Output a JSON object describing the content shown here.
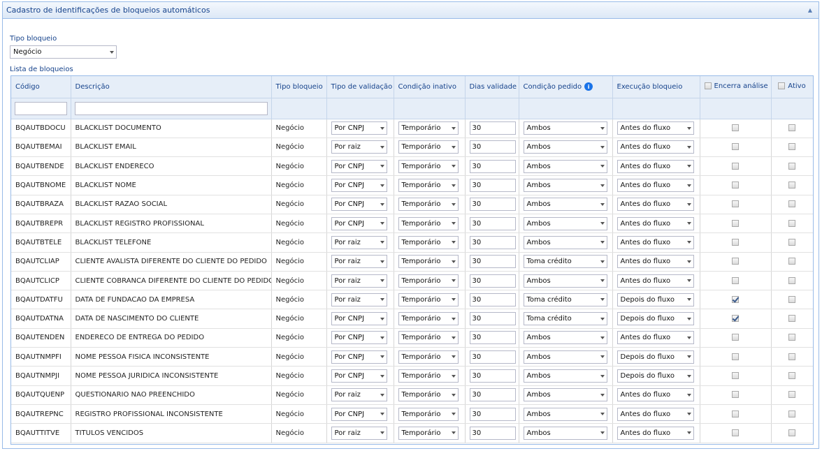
{
  "panel": {
    "title": "Cadastro de identificações de bloqueios automáticos"
  },
  "tipo_bloqueio": {
    "label": "Tipo bloqueio",
    "value": "Negócio"
  },
  "lista": {
    "label": "Lista de bloqueios"
  },
  "columns": {
    "codigo": "Código",
    "descricao": "Descrição",
    "tipo_bloqueio": "Tipo bloqueio",
    "tipo_validacao": "Tipo de validação",
    "condicao_inativo": "Condição inativo",
    "dias_validade": "Dias validade",
    "condicao_pedido": "Condição pedido",
    "execucao_bloqueio": "Execução bloqueio",
    "encerra_analise": "Encerra análise",
    "ativo": "Ativo"
  },
  "icons": {
    "info": "info-icon",
    "collapse": "chevron-up-icon",
    "dropdown": "chevron-down-icon"
  },
  "rows": [
    {
      "codigo": "BQAUTBDOCU",
      "descricao": "BLACKLIST DOCUMENTO",
      "tipo": "Negócio",
      "validacao": "Por CNPJ",
      "inativo": "Temporário",
      "dias": "30",
      "pedido": "Ambos",
      "execucao": "Antes do fluxo",
      "encerra": false,
      "ativo": false
    },
    {
      "codigo": "BQAUTBEMAI",
      "descricao": "BLACKLIST EMAIL",
      "tipo": "Negócio",
      "validacao": "Por raiz",
      "inativo": "Temporário",
      "dias": "30",
      "pedido": "Ambos",
      "execucao": "Antes do fluxo",
      "encerra": false,
      "ativo": false
    },
    {
      "codigo": "BQAUTBENDE",
      "descricao": "BLACKLIST ENDERECO",
      "tipo": "Negócio",
      "validacao": "Por CNPJ",
      "inativo": "Temporário",
      "dias": "30",
      "pedido": "Ambos",
      "execucao": "Antes do fluxo",
      "encerra": false,
      "ativo": false
    },
    {
      "codigo": "BQAUTBNOME",
      "descricao": "BLACKLIST NOME",
      "tipo": "Negócio",
      "validacao": "Por CNPJ",
      "inativo": "Temporário",
      "dias": "30",
      "pedido": "Ambos",
      "execucao": "Antes do fluxo",
      "encerra": false,
      "ativo": false
    },
    {
      "codigo": "BQAUTBRAZA",
      "descricao": "BLACKLIST RAZAO SOCIAL",
      "tipo": "Negócio",
      "validacao": "Por CNPJ",
      "inativo": "Temporário",
      "dias": "30",
      "pedido": "Ambos",
      "execucao": "Antes do fluxo",
      "encerra": false,
      "ativo": false
    },
    {
      "codigo": "BQAUTBREPR",
      "descricao": "BLACKLIST REGISTRO PROFISSIONAL",
      "tipo": "Negócio",
      "validacao": "Por CNPJ",
      "inativo": "Temporário",
      "dias": "30",
      "pedido": "Ambos",
      "execucao": "Antes do fluxo",
      "encerra": false,
      "ativo": false
    },
    {
      "codigo": "BQAUTBTELE",
      "descricao": "BLACKLIST TELEFONE",
      "tipo": "Negócio",
      "validacao": "Por raiz",
      "inativo": "Temporário",
      "dias": "30",
      "pedido": "Ambos",
      "execucao": "Antes do fluxo",
      "encerra": false,
      "ativo": false
    },
    {
      "codigo": "BQAUTCLIAP",
      "descricao": "CLIENTE AVALISTA DIFERENTE DO CLIENTE DO PEDIDO",
      "tipo": "Negócio",
      "validacao": "Por raiz",
      "inativo": "Temporário",
      "dias": "30",
      "pedido": "Toma crédito",
      "execucao": "Antes do fluxo",
      "encerra": false,
      "ativo": false
    },
    {
      "codigo": "BQAUTCLICP",
      "descricao": "CLIENTE COBRANCA DIFERENTE DO CLIENTE DO PEDIDO",
      "tipo": "Negócio",
      "validacao": "Por raiz",
      "inativo": "Temporário",
      "dias": "30",
      "pedido": "Ambos",
      "execucao": "Antes do fluxo",
      "encerra": false,
      "ativo": false
    },
    {
      "codigo": "BQAUTDATFU",
      "descricao": "DATA DE FUNDACAO DA EMPRESA",
      "tipo": "Negócio",
      "validacao": "Por raiz",
      "inativo": "Temporário",
      "dias": "30",
      "pedido": "Toma crédito",
      "execucao": "Depois do fluxo",
      "encerra": true,
      "ativo": false
    },
    {
      "codigo": "BQAUTDATNA",
      "descricao": "DATA DE NASCIMENTO DO CLIENTE",
      "tipo": "Negócio",
      "validacao": "Por CNPJ",
      "inativo": "Temporário",
      "dias": "30",
      "pedido": "Toma crédito",
      "execucao": "Depois do fluxo",
      "encerra": true,
      "ativo": false
    },
    {
      "codigo": "BQAUTENDEN",
      "descricao": "ENDERECO DE ENTREGA DO PEDIDO",
      "tipo": "Negócio",
      "validacao": "Por CNPJ",
      "inativo": "Temporário",
      "dias": "30",
      "pedido": "Ambos",
      "execucao": "Antes do fluxo",
      "encerra": false,
      "ativo": false
    },
    {
      "codigo": "BQAUTNMPFI",
      "descricao": "NOME PESSOA FISICA INCONSISTENTE",
      "tipo": "Negócio",
      "validacao": "Por CNPJ",
      "inativo": "Temporário",
      "dias": "30",
      "pedido": "Ambos",
      "execucao": "Depois do fluxo",
      "encerra": false,
      "ativo": false
    },
    {
      "codigo": "BQAUTNMPJI",
      "descricao": "NOME PESSOA JURIDICA INCONSISTENTE",
      "tipo": "Negócio",
      "validacao": "Por CNPJ",
      "inativo": "Temporário",
      "dias": "30",
      "pedido": "Ambos",
      "execucao": "Depois do fluxo",
      "encerra": false,
      "ativo": false
    },
    {
      "codigo": "BQAUTQUENP",
      "descricao": "QUESTIONARIO NAO PREENCHIDO",
      "tipo": "Negócio",
      "validacao": "Por raiz",
      "inativo": "Temporário",
      "dias": "30",
      "pedido": "Ambos",
      "execucao": "Antes do fluxo",
      "encerra": false,
      "ativo": false
    },
    {
      "codigo": "BQAUTREPNC",
      "descricao": "REGISTRO PROFISSIONAL INCONSISTENTE",
      "tipo": "Negócio",
      "validacao": "Por CNPJ",
      "inativo": "Temporário",
      "dias": "30",
      "pedido": "Ambos",
      "execucao": "Antes do fluxo",
      "encerra": false,
      "ativo": false
    },
    {
      "codigo": "BQAUTTITVE",
      "descricao": "TITULOS VENCIDOS",
      "tipo": "Negócio",
      "validacao": "Por raiz",
      "inativo": "Temporário",
      "dias": "30",
      "pedido": "Ambos",
      "execucao": "Antes do fluxo",
      "encerra": false,
      "ativo": false
    }
  ]
}
